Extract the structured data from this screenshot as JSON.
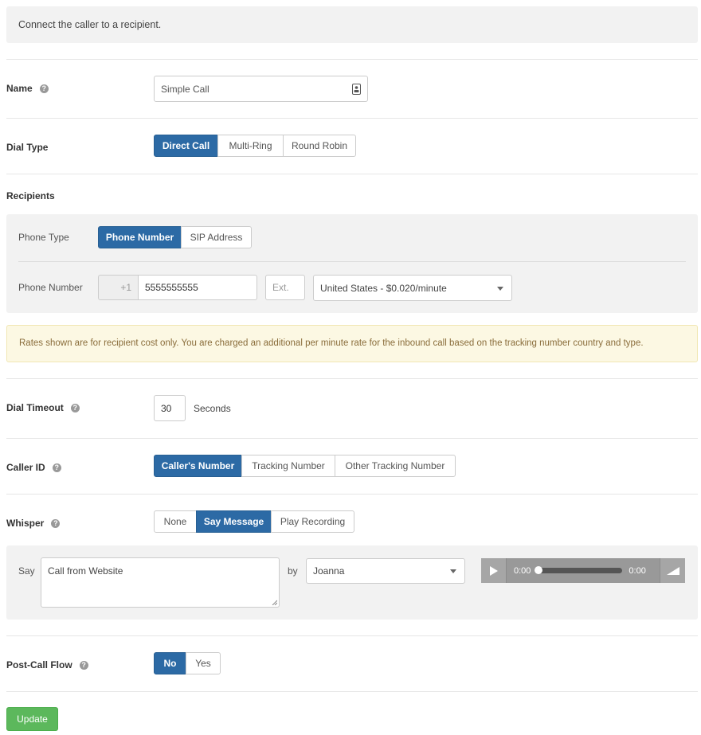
{
  "intro": {
    "text": "Connect the caller to a recipient."
  },
  "name": {
    "label": "Name",
    "value": "Simple Call",
    "help_icon": "question-circle-icon",
    "field_icon": "contact-card-icon"
  },
  "dial_type": {
    "label": "Dial Type",
    "options": [
      "Direct Call",
      "Multi-Ring",
      "Round Robin"
    ],
    "selected": "Direct Call"
  },
  "recipients": {
    "label": "Recipients",
    "phone_type": {
      "label": "Phone Type",
      "options": [
        "Phone Number",
        "SIP Address"
      ],
      "selected": "Phone Number"
    },
    "phone_number": {
      "label": "Phone Number",
      "country_code": "+1",
      "number": "5555555555",
      "ext_placeholder": "Ext.",
      "country_rate": "United States - $0.020/minute"
    }
  },
  "rates_notice": "Rates shown are for recipient cost only. You are charged an additional per minute rate for the inbound call based on the tracking number country and type.",
  "dial_timeout": {
    "label": "Dial Timeout",
    "value": "30",
    "unit": "Seconds"
  },
  "caller_id": {
    "label": "Caller ID",
    "options": [
      "Caller's Number",
      "Tracking Number",
      "Other Tracking Number"
    ],
    "selected": "Caller's Number"
  },
  "whisper": {
    "label": "Whisper",
    "options": [
      "None",
      "Say Message",
      "Play Recording"
    ],
    "selected": "Say Message",
    "say_label": "Say",
    "message": "Call from Website",
    "by_label": "by",
    "voice": "Joanna",
    "audio": {
      "current_time": "0:00",
      "duration": "0:00",
      "progress": 0
    }
  },
  "post_call_flow": {
    "label": "Post-Call Flow",
    "options": [
      "No",
      "Yes"
    ],
    "selected": "No"
  },
  "update_button": "Update",
  "colors": {
    "primary": "#2c6aa5",
    "success": "#5cb85c",
    "warning_bg": "#fcf8e3",
    "warning_text": "#8a6d3b"
  }
}
